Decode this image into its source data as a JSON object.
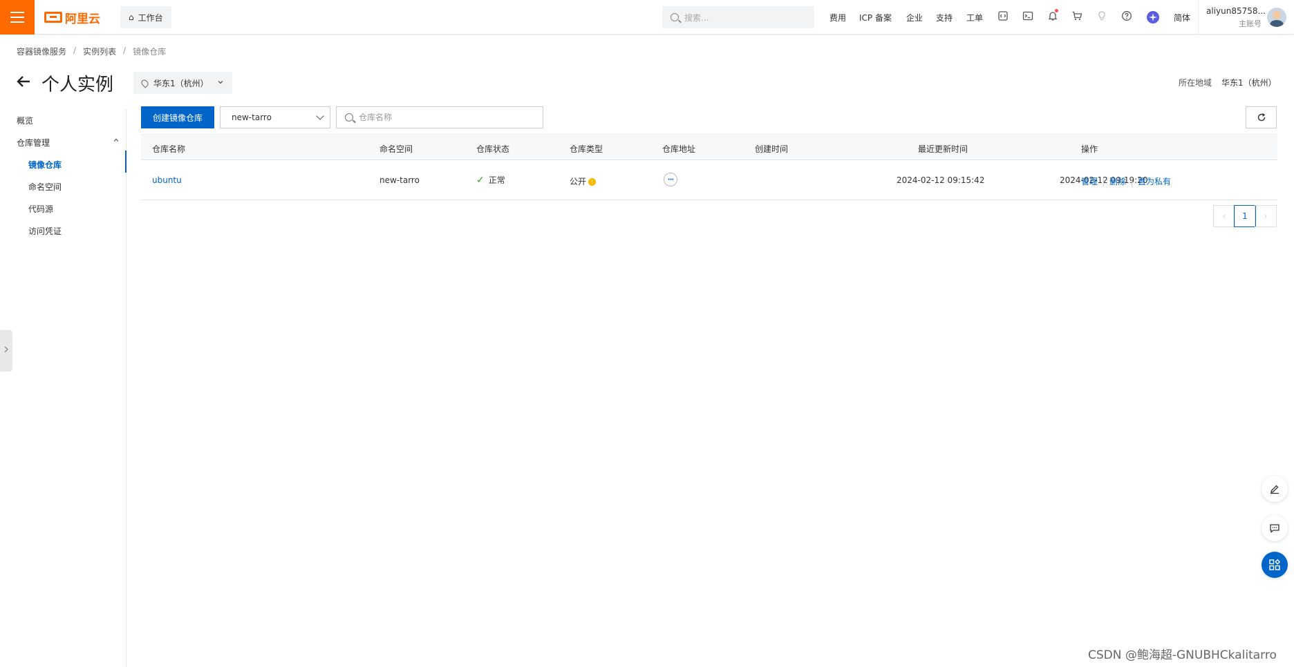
{
  "topbar": {
    "brand": "阿里云",
    "workbench_label": "工作台",
    "search_placeholder": "搜索...",
    "nav": [
      "费用",
      "ICP 备案",
      "企业",
      "支持",
      "工单"
    ],
    "icons": [
      "code-icon",
      "terminal-icon",
      "bell-icon",
      "cart-icon",
      "bulb-icon",
      "help-icon",
      "ai-assistant-icon"
    ],
    "language": "简体",
    "account_name": "aliyun85758...",
    "account_role": "主账号",
    "accent_color": "#ff6a00"
  },
  "breadcrumb": [
    "容器镜像服务",
    "实例列表",
    "镜像仓库"
  ],
  "page": {
    "title": "个人实例",
    "region_selector": "华东1（杭州）",
    "region_label": "所在地域",
    "region_value": "华东1（杭州）"
  },
  "sidebar": {
    "overview": "概览",
    "group": "仓库管理",
    "items": [
      "镜像仓库",
      "命名空间",
      "代码源",
      "访问凭证"
    ],
    "active_item": "镜像仓库"
  },
  "toolbar": {
    "create_button": "创建镜像仓库",
    "namespace_selected": "new-tarro",
    "search_placeholder": "仓库名称"
  },
  "table": {
    "columns": [
      "仓库名称",
      "命名空间",
      "仓库状态",
      "仓库类型",
      "仓库地址",
      "创建时间",
      "最近更新时间",
      "操作"
    ],
    "rows": [
      {
        "name": "ubuntu",
        "namespace": "new-tarro",
        "status": "正常",
        "type": "公开",
        "address_button": "···",
        "created": "2024-02-12 09:15:42",
        "updated": "2024-02-12 09:19:20",
        "actions": [
          "管理",
          "删除",
          "置为私有"
        ]
      }
    ]
  },
  "pagination": {
    "current_page": "1",
    "prev": "‹",
    "next": "›"
  },
  "watermark": "CSDN @鲍海超-GNUBHCkalitarro",
  "colors": {
    "primary": "#0064c8",
    "success": "#2ea121",
    "warning": "#f5b900"
  }
}
